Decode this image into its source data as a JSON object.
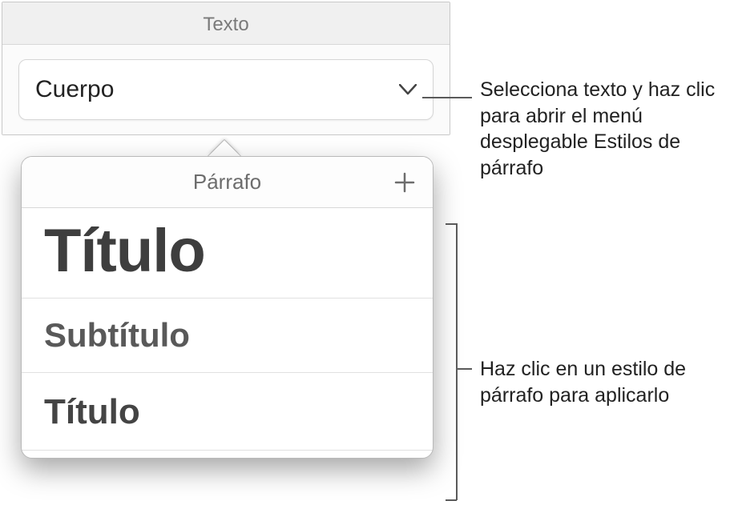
{
  "panel": {
    "title": "Texto"
  },
  "dropdown": {
    "label": "Cuerpo"
  },
  "popover": {
    "header": "Párrafo",
    "styles": [
      "Título",
      "Subtítulo",
      "Título"
    ]
  },
  "callouts": {
    "open_menu": "Selecciona texto y haz clic para abrir el menú desplegable Estilos de párrafo",
    "apply_style": "Haz clic en un estilo de párrafo para aplicarlo"
  }
}
